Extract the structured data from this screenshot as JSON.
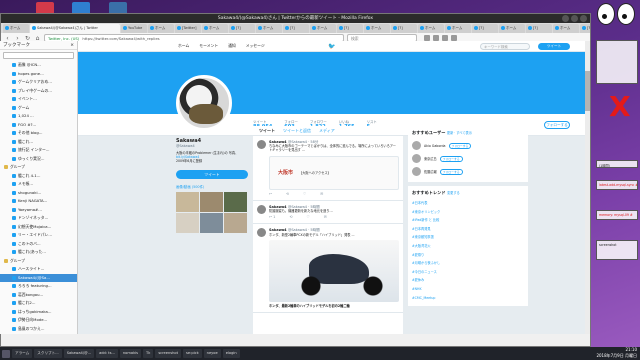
{
  "browser": {
    "window_title": "Sakawa4/(@Sakawa4)さん | Twitterからの最新ツイート - Mozilla Firefox",
    "active_tab": "Sakawa4/(@Sakawa4)さん | Twitter",
    "tabs": [
      "ホーム",
      "yoshiak",
      "YouTube",
      "ホーム",
      "[Twitter]",
      "ホーム",
      "[?]",
      "ホーム",
      "[?]",
      "ホーム",
      "[?]",
      "ホーム",
      "[?]",
      "ホーム",
      "ホーム",
      "[?]",
      "ホーム",
      "[?]",
      "ホーム",
      "[?]"
    ],
    "url_site": "Twitter, Inc. (US)",
    "url_path": "https://twitter.com/Sakawa4/with_replies",
    "search_placeholder": "検索"
  },
  "sidebar": {
    "title": "ブックマーク",
    "close": "×",
    "items": [
      {
        "label": "画像 @ICN...",
        "group": false
      },
      {
        "label": "hopes gone...",
        "group": false
      },
      {
        "label": "ゲームクリアおめ...",
        "group": false
      },
      {
        "label": "プレイ中ゲームの...",
        "group": false
      },
      {
        "label": "イベント...",
        "group": false
      },
      {
        "label": "ゲーム",
        "group": false
      },
      {
        "label": "1,024 ...",
        "group": false
      },
      {
        "label": "FGO #?...",
        "group": false
      },
      {
        "label": "その他 blog...",
        "group": false
      },
      {
        "label": "艦これ...",
        "group": false
      },
      {
        "label": "旅行記 インター...",
        "group": false
      },
      {
        "label": "ゆっくり実況...",
        "group": false
      },
      {
        "label": "グループ",
        "group": true
      },
      {
        "label": "艦これ 4-1...",
        "group": false
      },
      {
        "label": "メモ帳...",
        "group": false
      },
      {
        "label": "shogunaki...",
        "group": false
      },
      {
        "label": "Kenji NAGATA...",
        "group": false
      },
      {
        "label": "Yaeyama#...",
        "group": false
      },
      {
        "label": "ドンゾイネッタ...",
        "group": false
      },
      {
        "label": "幻想天使Mojaica...",
        "group": false
      },
      {
        "label": "リー・エイドパレ...",
        "group": false
      },
      {
        "label": "このトのバ...",
        "group": false
      },
      {
        "label": "艦これ(あった...",
        "group": false
      },
      {
        "label": "グループ",
        "group": true
      },
      {
        "label": "ハースライト...",
        "group": false
      },
      {
        "label": "Sakawa4/(@Sa...",
        "group": false,
        "selected": true
      },
      {
        "label": "ろろろ featuring...",
        "group": false
      },
      {
        "label": "葛西kongou...",
        "group": false
      },
      {
        "label": "艦これ2...",
        "group": false
      },
      {
        "label": "はっちgakimaka...",
        "group": false
      },
      {
        "label": "伊勢日向Mode...",
        "group": false
      },
      {
        "label": "島風のつかえ...",
        "group": false
      }
    ]
  },
  "twitter": {
    "nav": [
      "ホーム",
      "モーメント",
      "通知",
      "メッセージ"
    ],
    "search_placeholder": "キーワード検索",
    "tweet_button": "ツイート",
    "stats": [
      {
        "label": "ツイート",
        "value": "88,954"
      },
      {
        "label": "フォロー",
        "value": "603"
      },
      {
        "label": "フォロワー",
        "value": "1,822"
      },
      {
        "label": "いいね",
        "value": "1,765"
      },
      {
        "label": "リスト",
        "value": "5"
      }
    ],
    "follow_button": "フォローする",
    "profile": {
      "name": "Sakawa4",
      "handle": "@Sakawa4",
      "bio": "大阪の半蔵のProblemer (生まれ)の 写真、",
      "link": "bit.ly/Sakawa4",
      "joined": "2009年6月に登録",
      "tweet_to": "ツイート",
      "media_label": "画像/動画 (500件)"
    },
    "timeline_tabs": [
      "ツイート",
      "ツイートと返信",
      "メディア"
    ],
    "tweets": [
      {
        "name": "Sakawa4",
        "handle": "@Sakawa4 · 58分",
        "text": "ちなみに大阪市のゴーテーマとばかりは、全体的に進んでる。場所によっていろいろアートギャラリーを見出す ...",
        "card": "大阪市",
        "card_sub": "【大阪へのアクセス】",
        "acts": [
          "↩",
          "⟲",
          "♡",
          "✉"
        ]
      },
      {
        "name": "Sakawa4",
        "handle": "@Sakawa4 · 5時間",
        "text": "防護服姿も。機器更新を新たな地元を造り...",
        "acts": [
          "↩ 1",
          "⟲",
          "♡",
          "✉"
        ]
      },
      {
        "name": "Sakawa4",
        "handle": "@Sakawa4 · 5時間",
        "text": "ホンダ、新型2輪車PCXの新モデル「ハイブリッド」発表 ...",
        "caption": "ホンダ、最新2輪車のハイブリッドモデルを初の2輪二輪",
        "acts": [
          "↩",
          "⟲",
          "♡",
          "✉"
        ]
      }
    ],
    "who_to_follow": {
      "title": "おすすめユーザー",
      "more": "更新 · すべて表示",
      "users": [
        {
          "name": "Akio Gaborda",
          "btn": "フォローする"
        },
        {
          "name": "東京広島",
          "btn": "フォローする"
        },
        {
          "name": "佐藤広報",
          "btn": "フォローする"
        }
      ]
    },
    "trends": {
      "title": "おすすめトレンド",
      "more": "変更する",
      "items": [
        "#日本代表",
        "#東京オリンピック",
        "#iPad新作 と 比較",
        "#日本再発見",
        "#東京都知事選",
        "#大阪湾花火",
        "#夏祭り",
        "#月曜から夜ふかし",
        "#今日のニュース",
        "#夏休み",
        "#NHK",
        "#CMC_Meetup"
      ]
    }
  },
  "desktop": {
    "widgets": [
      "(1時間)",
      "latest-add-mysql-sync #",
      "memory: mysql-09 #",
      "screenshot"
    ],
    "x_mark": "X"
  },
  "taskbar": {
    "apps": [
      "アラーム",
      "スクリプト...",
      "Sakawa4/@...",
      "add: ts...",
      "nomakis",
      "Tk",
      "screenshot",
      "se:pick",
      "neyoe",
      "elogin"
    ],
    "time": "21:10",
    "date": "2018年7月9日 月曜日"
  }
}
